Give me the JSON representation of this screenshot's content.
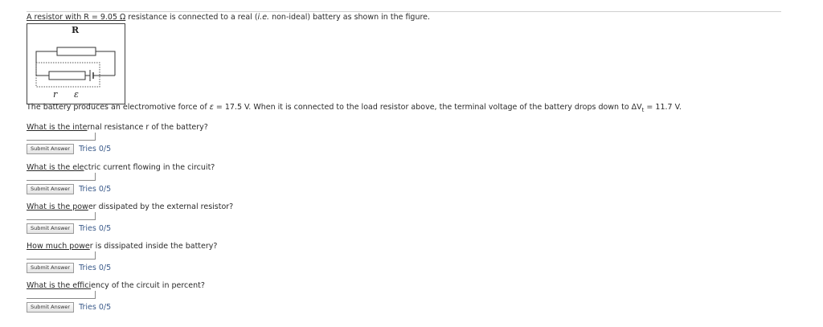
{
  "intro": {
    "prefix": "A resistor with R = 9.05 ",
    "unit": "Ω",
    "suffix": " resistance is connected to a real (",
    "ie": "i.e.",
    "end": " non-ideal) battery as shown in the figure."
  },
  "figure": {
    "label_R": "R",
    "label_r": "r",
    "label_emf": "ε"
  },
  "emf_line": {
    "text1": "The battery produces an electromotive force of ",
    "emf_symbol": "ε",
    "text2": " = 17.5 V. When it is connected to the load resistor above, the terminal voltage of the battery drops down to ",
    "delta": "ΔV",
    "sub": "t",
    "text3": " = 11.7 V."
  },
  "questions": [
    {
      "u": "What is the inte",
      "rest": "rnal resistance r of the battery?",
      "button": "Submit Answer",
      "tries": "Tries 0/5"
    },
    {
      "u": "What is the ele",
      "rest": "ctric current flowing in the circuit?",
      "button": "Submit Answer",
      "tries": "Tries 0/5"
    },
    {
      "u": "What is the pow",
      "rest": "er dissipated by the external resistor?",
      "button": "Submit Answer",
      "tries": "Tries 0/5"
    },
    {
      "u": "How much powe",
      "rest": "r is dissipated inside the battery?",
      "button": "Submit Answer",
      "tries": "Tries 0/5"
    },
    {
      "u": "What is the effici",
      "rest": "ency of the circuit in percent?",
      "button": "Submit Answer",
      "tries": "Tries 0/5"
    }
  ]
}
